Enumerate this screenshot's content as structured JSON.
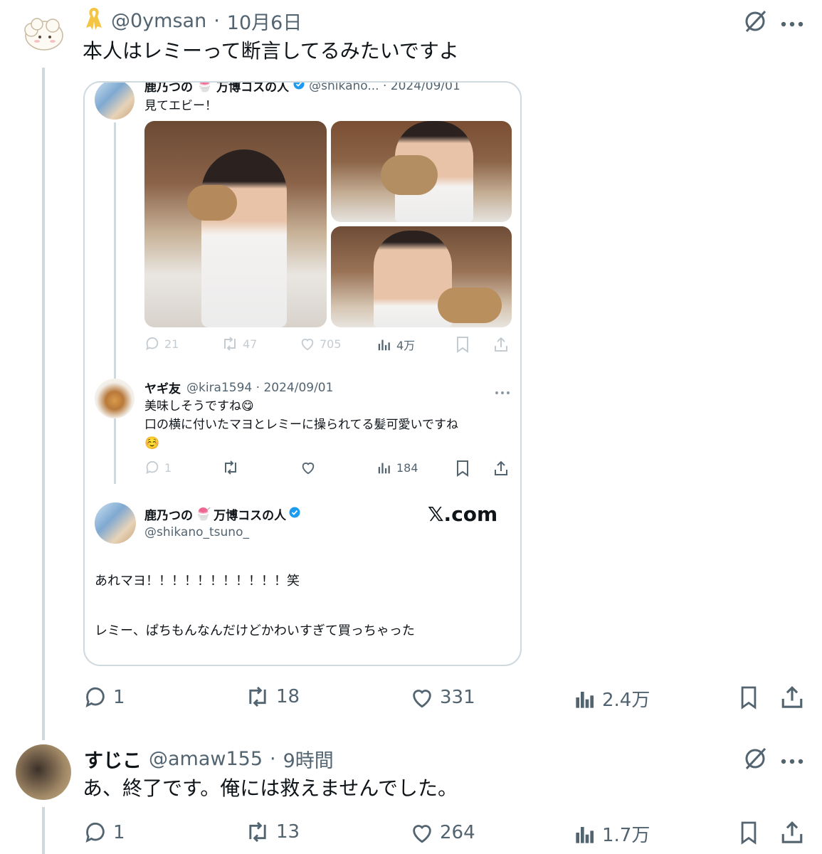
{
  "post1": {
    "display_name": "",
    "handle": "@0ymsan",
    "separator": "·",
    "date": "10月6日",
    "text": "本人はレミーって断言してるみたいですよ",
    "actions": {
      "reply": "1",
      "repost": "18",
      "like": "331",
      "views": "2.4万"
    }
  },
  "embed": {
    "tweet1": {
      "name": "鹿乃つの",
      "name_suffix": "万博コスの人",
      "handle_date": "@shikano... · 2024/09/01",
      "text": "見てエビー！",
      "actions": {
        "reply": "21",
        "repost": "47",
        "like": "705",
        "views": "4万"
      }
    },
    "tweet2": {
      "name": "ヤギ友",
      "handle_date": "@kira1594 · 2024/09/01",
      "line1": "美味しそうですね😋",
      "line2": "口の横に付いたマヨとレミーに操られてる髪可愛いですね",
      "line3": "☺️",
      "actions": {
        "reply": "1",
        "views": "184"
      }
    },
    "card": {
      "name": "鹿乃つの",
      "name_suffix": "万博コスの人",
      "handle": "@shikano_tsuno_",
      "brand": "𝕏.com",
      "body1": "あれマヨ！！！！！！！！！！！笑",
      "body2": "レミー、ぱちもんなんだけどかわいすぎて買っちゃった"
    }
  },
  "post2": {
    "display_name": "すじこ",
    "handle": "@amaw155",
    "separator": "·",
    "date": "9時間",
    "text": "あ、終了です。俺には救えませんでした。",
    "actions": {
      "reply": "1",
      "repost": "13",
      "like": "264",
      "views": "1.7万"
    }
  },
  "colors": {
    "text": "#0f1419",
    "secondary": "#536471",
    "line": "#cfd9de",
    "verified": "#1d9bf0",
    "ribbon": "#f4c542"
  }
}
